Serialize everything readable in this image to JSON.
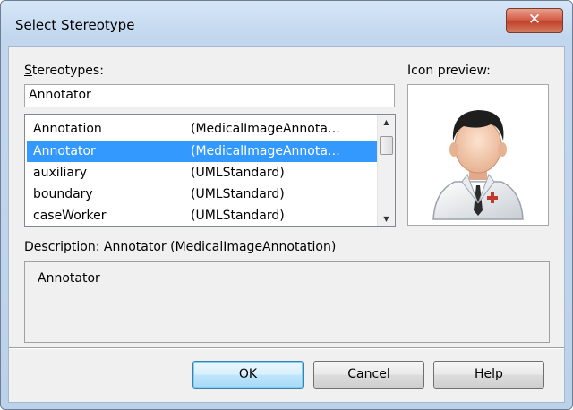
{
  "window": {
    "title": "Select Stereotype",
    "close_glyph": "✕"
  },
  "stereotypes": {
    "label_accel": "S",
    "label_rest": "tereotypes:",
    "input_value": "Annotator",
    "items": [
      {
        "name": "Annotation",
        "profile": "(MedicalImageAnnota…",
        "selected": false
      },
      {
        "name": "Annotator",
        "profile": "(MedicalImageAnnota…",
        "selected": true
      },
      {
        "name": "auxiliary",
        "profile": "(UMLStandard)",
        "selected": false
      },
      {
        "name": "boundary",
        "profile": "(UMLStandard)",
        "selected": false
      },
      {
        "name": "caseWorker",
        "profile": "(UMLStandard)",
        "selected": false
      }
    ]
  },
  "preview": {
    "label": "Icon preview:",
    "icon": "doctor-icon"
  },
  "description": {
    "label": "Description: Annotator (MedicalImageAnnotation)",
    "text": "Annotator"
  },
  "buttons": {
    "ok": "OK",
    "cancel": "Cancel",
    "help": "Help"
  },
  "colors": {
    "selection": "#3399ff",
    "close_button": "#c1432d",
    "title_bar": "#c2d7ee"
  }
}
